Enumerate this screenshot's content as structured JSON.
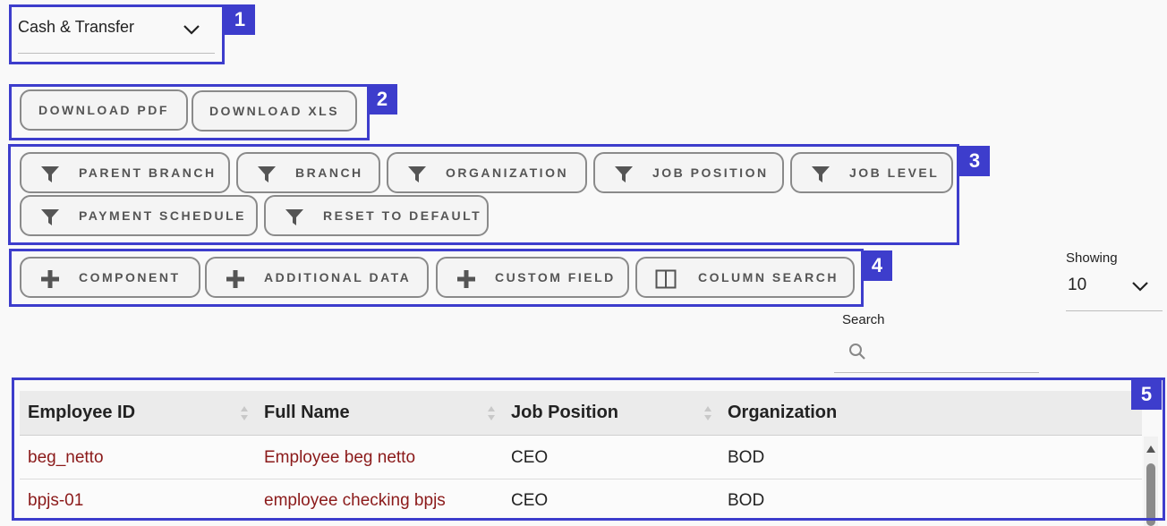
{
  "payroll_select": {
    "value": "Cash & Transfer"
  },
  "downloads": {
    "pdf": "DOWNLOAD PDF",
    "xls": "DOWNLOAD XLS"
  },
  "filters": [
    {
      "label": "PARENT BRANCH"
    },
    {
      "label": "BRANCH"
    },
    {
      "label": "ORGANIZATION"
    },
    {
      "label": "JOB POSITION"
    },
    {
      "label": "JOB LEVEL"
    },
    {
      "label": "PAYMENT SCHEDULE"
    },
    {
      "label": "RESET TO DEFAULT"
    }
  ],
  "actions": [
    {
      "label": "COMPONENT",
      "icon": "plus-icon"
    },
    {
      "label": "ADDITIONAL DATA",
      "icon": "plus-icon"
    },
    {
      "label": "CUSTOM FIELD",
      "icon": "plus-icon"
    },
    {
      "label": "COLUMN SEARCH",
      "icon": "columns-icon"
    }
  ],
  "showing": {
    "label": "Showing",
    "value": "10"
  },
  "search": {
    "label": "Search",
    "placeholder": ""
  },
  "table": {
    "columns": [
      "Employee ID",
      "Full Name",
      "Job Position",
      "Organization"
    ],
    "rows": [
      [
        "beg_netto",
        "Employee beg netto",
        "CEO",
        "BOD"
      ],
      [
        "bpjs-01",
        "employee checking bpjs",
        "CEO",
        "BOD"
      ]
    ]
  },
  "annotations": [
    "1",
    "2",
    "3",
    "4",
    "5"
  ],
  "colors": {
    "annotation": "#3d3dcc",
    "link": "#8b1a1a",
    "button_border": "#8a8a8a",
    "background": "#f9f9f9"
  }
}
